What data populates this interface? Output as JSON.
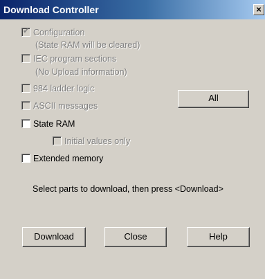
{
  "window": {
    "title": "Download Controller",
    "close_glyph": "×"
  },
  "options": {
    "configuration": {
      "label": "Configuration",
      "checked": true,
      "enabled": false
    },
    "configuration_note": "(State RAM will be cleared)",
    "iec_sections": {
      "label": "IEC program sections",
      "checked": false,
      "enabled": false
    },
    "iec_note": "(No Upload information)",
    "ladder_logic": {
      "label": "984 ladder logic",
      "checked": false,
      "enabled": false
    },
    "ascii_messages": {
      "label": "ASCII messages",
      "checked": false,
      "enabled": false
    },
    "state_ram": {
      "label": "State RAM",
      "checked": false,
      "enabled": true
    },
    "initial_values": {
      "label": "Initial values only",
      "checked": false,
      "enabled": false
    },
    "extended_memory": {
      "label": "Extended memory",
      "checked": false,
      "enabled": true
    }
  },
  "buttons": {
    "all": "All",
    "download": "Download",
    "close": "Close",
    "help": "Help"
  },
  "instruction": "Select parts to download, then press <Download>"
}
